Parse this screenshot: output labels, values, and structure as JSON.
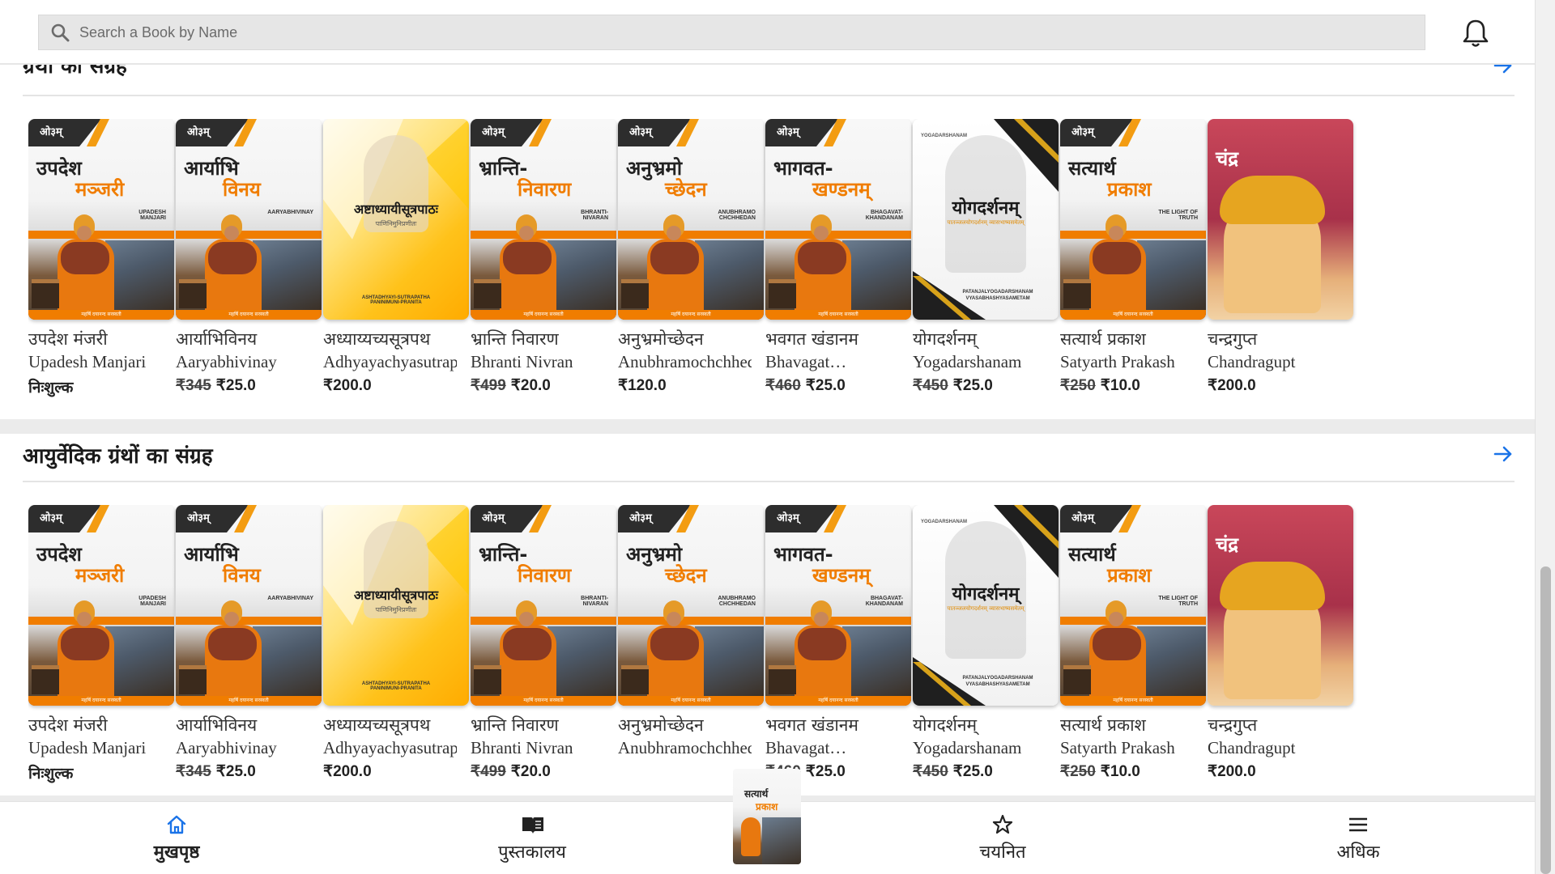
{
  "search": {
    "placeholder": "Search a Book by Name"
  },
  "sections": [
    {
      "title": "ग्रंथों का संग्रह",
      "books": [
        {
          "hi": "उपदेश मंजरी",
          "en": "Upadesh Manjari",
          "old": "",
          "price": "निःशुल्क",
          "free": true,
          "cover": "portrait",
          "cover_title_a": "उपदेश",
          "cover_title_b": "मञ्जरी",
          "cover_sub": "UPADESH MANJARI"
        },
        {
          "hi": "आर्याभिविनय",
          "en": "Aaryabhivinay",
          "old": "₹345",
          "price": "₹25.0",
          "free": false,
          "cover": "portrait",
          "cover_title_a": "आर्याभि",
          "cover_title_b": "विनय",
          "cover_sub": "AARYABHIVINAY"
        },
        {
          "hi": "अध्याय्यच्यसूत्रपथ",
          "en": "Adhyayachyasutrapath",
          "old": "",
          "price": "₹200.0",
          "free": false,
          "cover": "yellow",
          "cover_title_a": "अष्टाध्यायीसूत्रपाठः",
          "cover_title_b": "पाणिनिमुनिप्रणीतः",
          "cover_sub": "ASHTADHYAYI-SUTRAPATHA PANINIMUNI-PRANITA"
        },
        {
          "hi": "भ्रान्ति निवारण",
          "en": "Bhranti Nivran",
          "old": "₹499",
          "price": "₹20.0",
          "free": false,
          "cover": "portrait",
          "cover_title_a": "भ्रान्ति-",
          "cover_title_b": "निवारण",
          "cover_sub": "BHRANTI- NIVARAN"
        },
        {
          "hi": "अनुभ्रमोच्छेदन",
          "en": "Anubhramochchhedan",
          "old": "",
          "price": "₹120.0",
          "free": false,
          "cover": "portrait",
          "cover_title_a": "अनुभ्रमो",
          "cover_title_b": "च्छेदन",
          "cover_sub": "ANUBHRAMO CHCHHEDAN"
        },
        {
          "hi": "भवगत खंडानम",
          "en": "Bhavagat…",
          "old": "₹460",
          "price": "₹25.0",
          "free": false,
          "cover": "portrait",
          "cover_title_a": "भागवत-",
          "cover_title_b": "खण्डनम्",
          "cover_sub": "BHAGAVAT- KHANDANAM"
        },
        {
          "hi": "योगदर्शनम्",
          "en": "Yogadarshanam",
          "old": "₹450",
          "price": "₹25.0",
          "free": false,
          "cover": "yoga",
          "cover_title_a": "योगदर्शनम्",
          "cover_title_b": "पातञ्जलयोगदर्शनम् व्यासभाष्यसमेतम्",
          "cover_sub": "PATANJALYOGADARSHANAM VYASABHASHYASAMETAM"
        },
        {
          "hi": "सत्यार्थ प्रकाश",
          "en": "Satyarth Prakash",
          "old": "₹250",
          "price": "₹10.0",
          "free": false,
          "cover": "portrait",
          "cover_title_a": "सत्यार्थ",
          "cover_title_b": "प्रकाश",
          "cover_sub": "THE LIGHT OF TRUTH"
        },
        {
          "hi": "चन्द्रगुप्त",
          "en": "Chandragupt",
          "old": "",
          "price": "₹200.0",
          "free": false,
          "cover": "red",
          "cover_title_a": "चंद्र",
          "cover_title_b": "",
          "cover_sub": ""
        }
      ]
    },
    {
      "title": "आयुर्वेदिक ग्रंथों का संग्रह",
      "books": [
        {
          "hi": "उपदेश मंजरी",
          "en": "Upadesh Manjari",
          "old": "",
          "price": "निःशुल्क",
          "free": true,
          "cover": "portrait",
          "cover_title_a": "उपदेश",
          "cover_title_b": "मञ्जरी",
          "cover_sub": "UPADESH MANJARI"
        },
        {
          "hi": "आर्याभिविनय",
          "en": "Aaryabhivinay",
          "old": "₹345",
          "price": "₹25.0",
          "free": false,
          "cover": "portrait",
          "cover_title_a": "आर्याभि",
          "cover_title_b": "विनय",
          "cover_sub": "AARYABHIVINAY"
        },
        {
          "hi": "अध्याय्यच्यसूत्रपथ",
          "en": "Adhyayachyasutrapath",
          "old": "",
          "price": "₹200.0",
          "free": false,
          "cover": "yellow",
          "cover_title_a": "अष्टाध्यायीसूत्रपाठः",
          "cover_title_b": "पाणिनिमुनिप्रणीतः",
          "cover_sub": "ASHTADHYAYI-SUTRAPATHA PANINIMUNI-PRANITA"
        },
        {
          "hi": "भ्रान्ति निवारण",
          "en": "Bhranti Nivran",
          "old": "₹499",
          "price": "₹20.0",
          "free": false,
          "cover": "portrait",
          "cover_title_a": "भ्रान्ति-",
          "cover_title_b": "निवारण",
          "cover_sub": "BHRANTI- NIVARAN"
        },
        {
          "hi": "अनुभ्रमोच्छेदन",
          "en": "Anubhramochchhedan",
          "old": "",
          "price": "",
          "free": false,
          "cover": "portrait",
          "cover_title_a": "अनुभ्रमो",
          "cover_title_b": "च्छेदन",
          "cover_sub": "ANUBHRAMO CHCHHEDAN"
        },
        {
          "hi": "भवगत खंडानम",
          "en": "Bhavagat…",
          "old": "₹460",
          "price": "₹25.0",
          "free": false,
          "cover": "portrait",
          "cover_title_a": "भागवत-",
          "cover_title_b": "खण्डनम्",
          "cover_sub": "BHAGAVAT- KHANDANAM"
        },
        {
          "hi": "योगदर्शनम्",
          "en": "Yogadarshanam",
          "old": "₹450",
          "price": "₹25.0",
          "free": false,
          "cover": "yoga",
          "cover_title_a": "योगदर्शनम्",
          "cover_title_b": "पातञ्जलयोगदर्शनम् व्यासभाष्यसमेतम्",
          "cover_sub": "PATANJALYOGADARSHANAM VYASABHASHYASAMETAM"
        },
        {
          "hi": "सत्यार्थ प्रकाश",
          "en": "Satyarth Prakash",
          "old": "₹250",
          "price": "₹10.0",
          "free": false,
          "cover": "portrait",
          "cover_title_a": "सत्यार्थ",
          "cover_title_b": "प्रकाश",
          "cover_sub": "THE LIGHT OF TRUTH"
        },
        {
          "hi": "चन्द्रगुप्त",
          "en": "Chandragupt",
          "old": "",
          "price": "₹200.0",
          "free": false,
          "cover": "red",
          "cover_title_a": "चंद्र",
          "cover_title_b": "",
          "cover_sub": ""
        }
      ]
    }
  ],
  "cover_common": {
    "om": "ओ३म्",
    "footer": "महर्षि दयानन्द सरस्वती"
  },
  "nav": {
    "home": "मुखपृष्ठ",
    "library": "पुस्तकालय",
    "current_book_title_a": "सत्यार्थ",
    "current_book_title_b": "प्रकाश",
    "selected": "चयनित",
    "more": "अधिक"
  },
  "colors": {
    "accent": "#1a73e8",
    "orange": "#f07d00",
    "nav_active": "#1a73e8"
  },
  "icons": {
    "search": "search-icon",
    "bell": "bell-icon",
    "arrow": "arrow-right-icon",
    "home": "home-icon",
    "library": "book-open-icon",
    "star": "star-icon",
    "menu": "menu-icon"
  }
}
